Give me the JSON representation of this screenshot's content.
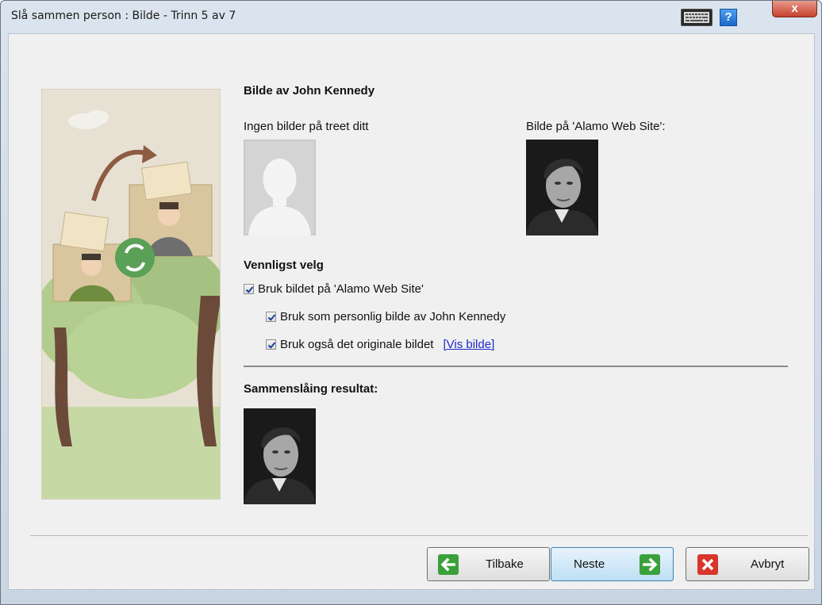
{
  "window": {
    "title": "Slå sammen person : Bilde - Trinn 5 av 7",
    "help_label": "?",
    "close_label": "x"
  },
  "section": {
    "heading": "Bilde av John Kennedy",
    "left_caption": "Ingen bilder på treet ditt",
    "right_caption": "Bilde på 'Alamo Web Site':"
  },
  "choose": {
    "heading": "Vennligst velg",
    "opt_use_image": "Bruk bildet på 'Alamo Web Site'",
    "opt_personal": "Bruk som personlig bilde av John Kennedy",
    "opt_original": "Bruk også det originale bildet",
    "link_open": "[",
    "link_label": "Vis bilde",
    "link_close": "]"
  },
  "result": {
    "heading": "Sammenslåing resultat:"
  },
  "buttons": {
    "back": "Tilbake",
    "next": "Neste",
    "cancel": "Avbryt"
  },
  "colors": {
    "accent_green": "#3aa13a",
    "cancel_red": "#d9362b",
    "link_blue": "#1d27c8"
  }
}
